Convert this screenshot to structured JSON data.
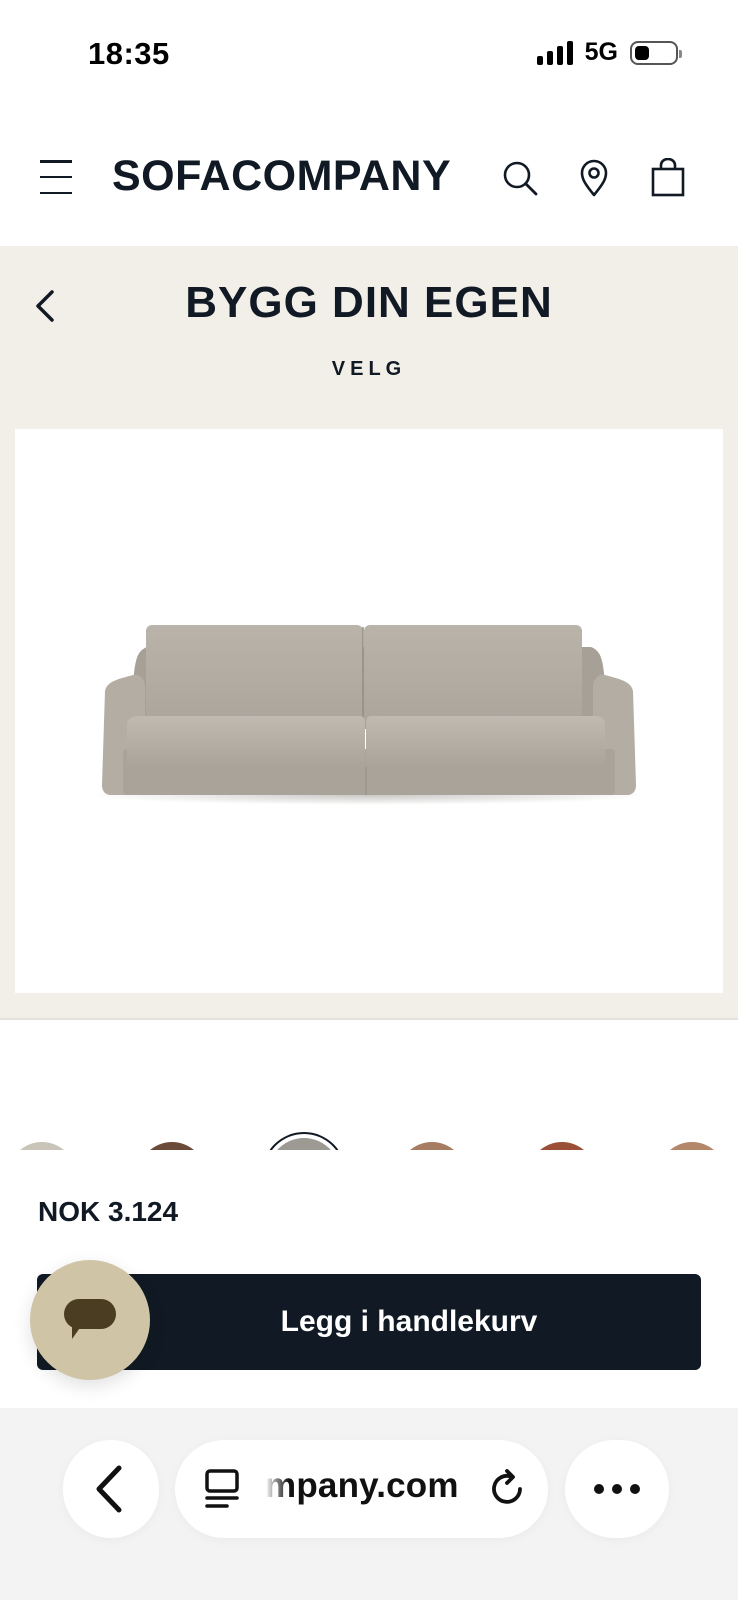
{
  "status_bar": {
    "time": "18:35",
    "network": "5G",
    "battery_level": 0.3
  },
  "header": {
    "logo": "SOFACOMPANY",
    "icons": [
      "menu-icon",
      "search-icon",
      "location-pin-icon",
      "shopping-bag-icon"
    ]
  },
  "configurator": {
    "title": "BYGG DIN EGEN",
    "subtitle": "VELG",
    "product_image_alt": "sofa-image",
    "background_color": "#f2efe9"
  },
  "swatches": [
    {
      "color": "#c9c4b8",
      "selected": false
    },
    {
      "color": "#6b4a3a",
      "selected": false
    },
    {
      "color": "#9c9a93",
      "selected": true
    },
    {
      "color": "#a67d62",
      "selected": false
    },
    {
      "color": "#9a4f36",
      "selected": false
    },
    {
      "color": "#b4876a",
      "selected": false
    }
  ],
  "purchase": {
    "price": "NOK 3.124",
    "add_to_cart_label": "Legg i handlekurv",
    "button_color": "#111a24"
  },
  "chat": {
    "icon": "chat-bubble-icon",
    "color": "#cfc4a6"
  },
  "browser": {
    "url": "mpany.com",
    "icons": [
      "back-arrow-icon",
      "page-icon",
      "reload-icon",
      "more-icon"
    ]
  }
}
